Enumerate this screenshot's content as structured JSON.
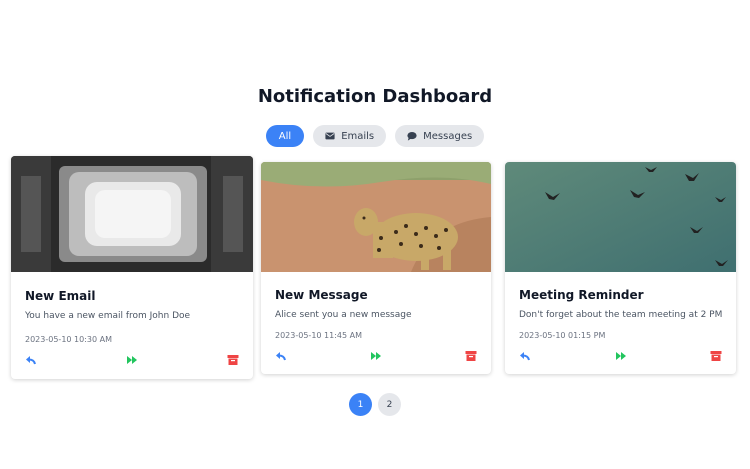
{
  "header": {
    "title": "Notification Dashboard"
  },
  "filters": [
    {
      "label": "All",
      "icon": "none",
      "active": true
    },
    {
      "label": "Emails",
      "icon": "envelope-icon",
      "active": false
    },
    {
      "label": "Messages",
      "icon": "chat-bubble-icon",
      "active": false
    }
  ],
  "notifications": [
    {
      "title": "New Email",
      "message": "You have a new email from John Doe",
      "time": "2023-05-10 10:30 AM",
      "image": "vintage-tv-screen-photo"
    },
    {
      "title": "New Message",
      "message": "Alice sent you a new message",
      "time": "2023-05-10 11:45 AM",
      "image": "leopard-on-dirt-road-photo"
    },
    {
      "title": "Meeting Reminder",
      "message": "Don't forget about the team meeting at 2 PM",
      "time": "2023-05-10 01:15 PM",
      "image": "birds-in-sky-photo"
    }
  ],
  "actions": {
    "reply_icon": "reply-icon",
    "forward_icon": "fast-forward-icon",
    "archive_icon": "archive-icon"
  },
  "pagination": {
    "pages": [
      "1",
      "2"
    ],
    "current": "1"
  },
  "colors": {
    "accent": "#3b82f6",
    "reply": "#3b82f6",
    "forward": "#22c55e",
    "archive": "#ef4444",
    "chip_bg": "#e5e7eb"
  }
}
